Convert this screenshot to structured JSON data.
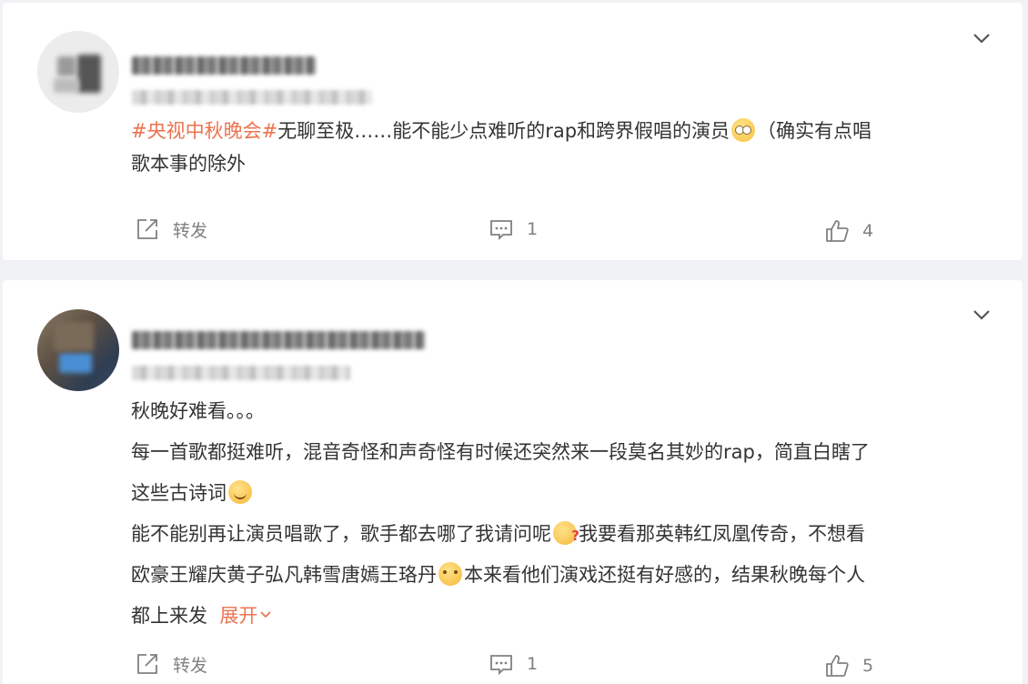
{
  "comments": [
    {
      "hashtag": "#央视中秋晚会#",
      "text_after_hashtag": "无聊至极……能不能少点难听的rap和跨界假唱的演员",
      "text_after_emoji": "（确实有点唱",
      "line2": "歌本事的除外",
      "actions": {
        "repost_label": "转发",
        "comment_count": "1",
        "like_count": "4"
      }
    },
    {
      "line1": "秋晚好难看。。。",
      "line2": "每一首歌都挺难听，混音奇怪和声奇怪有时候还突然来一段莫名其妙的rap，简直白瞎了",
      "line3": "这些古诗词",
      "line4a": "能不能别再让演员唱歌了，歌手都去哪了我请问呢",
      "line4b": "我要看那英韩红凤凰传奇，不想看",
      "line5a": "欧豪王耀庆黄子弘凡韩雪唐嫣王珞丹",
      "line5b": "本来看他们演戏还挺有好感的，结果秋晚每个人",
      "line6": "都上来发",
      "expand_label": "展开",
      "actions": {
        "repost_label": "转发",
        "comment_count": "1",
        "like_count": "5"
      }
    }
  ],
  "icons": [
    "repost-icon",
    "comment-icon",
    "like-icon",
    "chevron-down-icon"
  ],
  "colors": {
    "hashtag": "#eb7350",
    "action_text": "#808080",
    "background": "#f1f2f5"
  }
}
